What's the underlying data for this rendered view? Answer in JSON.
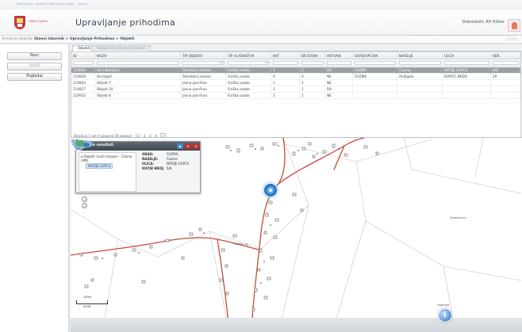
{
  "header": {
    "tiny_left": "Grad Čazma · Gradski informacijski sustav",
    "tiny_mid": "Čazma",
    "logo_text": "GRAD ČAZMA",
    "title": "Upravljanje prihodima",
    "user": "Dobrodošli, RH Editor",
    "top_links": "GLAVNI IZBORNIK  |  MOJE POSTAVKE  |  PROMJENA LOZINKE  |  ODJAVA",
    "version": "v.3.0.2"
  },
  "breadcrumb": {
    "prefix": "Trenutna lokacija:",
    "path": "Glavni izbornik > Upravljanje Prihodima > Objekti"
  },
  "left_buttons": [
    "Novi",
    "Izbriši",
    "Pogledaj"
  ],
  "tabs": [
    "Objekti",
    "Objekti za zakupne odnose"
  ],
  "grid": {
    "columns": [
      "ID",
      "NAZIV",
      "TIP OBJEKTA",
      "TIP VLASNIŠTVA",
      "KAT",
      "BR.STANA",
      "AKTIVAN",
      "GRAD/OPĆINA",
      "NASELJE",
      "ULICA",
      "KBR"
    ],
    "rows": [
      [
        "110930",
        "Ulici Natalijan",
        "Stambeni prostor",
        "Fizička osoba",
        "1",
        "2",
        "DA",
        "ČAZMA",
        "Čazma",
        "MATIJE GUPCA",
        "6/8"
      ],
      [
        "110928",
        "Dorisqa4",
        "Stambeni prostor",
        "Fizička osoba",
        "0",
        "0",
        "NE",
        "ČAZMA",
        "Andigola",
        "KOPČIĆ BRDO",
        "29"
      ],
      [
        "110924",
        "Objekt 7",
        "Javna površina",
        "Fizička osoba",
        "1",
        "1",
        "NE",
        "",
        "",
        "",
        ""
      ],
      [
        "110927",
        "Objekt 10",
        "Javna površina",
        "Fizička osoba",
        "1",
        "1",
        "DA",
        "",
        "",
        "",
        ""
      ],
      [
        "110925",
        "Objekt 8",
        "Javna površina",
        "Fizička osoba",
        "1",
        "1",
        "NE",
        "",
        "",
        "",
        ""
      ]
    ]
  },
  "pager": {
    "text": "Stranica 1 od 4 (ukupno 20 zapisa)",
    "current": "[1]",
    "pages": [
      "2",
      "3",
      "4"
    ],
    "next": ">"
  },
  "info_panel": {
    "title": "Info rezultati",
    "tree_root": "Objekti i kućni brojevi - Čazma (4M)",
    "tree_selected": "MATIJE GUPCA",
    "attrs": [
      {
        "key": "GRAD:",
        "value": "ČAZMA"
      },
      {
        "key": "NASELJE:",
        "value": "Čazma"
      },
      {
        "key": "ULICA:",
        "value": "MATIJE GUPCA"
      },
      {
        "key": "KUĆNI BROJ:",
        "value": "6/8"
      }
    ]
  },
  "map": {
    "place_labels": [
      "Čazma",
      "Grabovnica"
    ],
    "scale_labels": [
      "100m",
      "400ft"
    ],
    "legend_label": "Legenda",
    "info_icon": "i"
  }
}
